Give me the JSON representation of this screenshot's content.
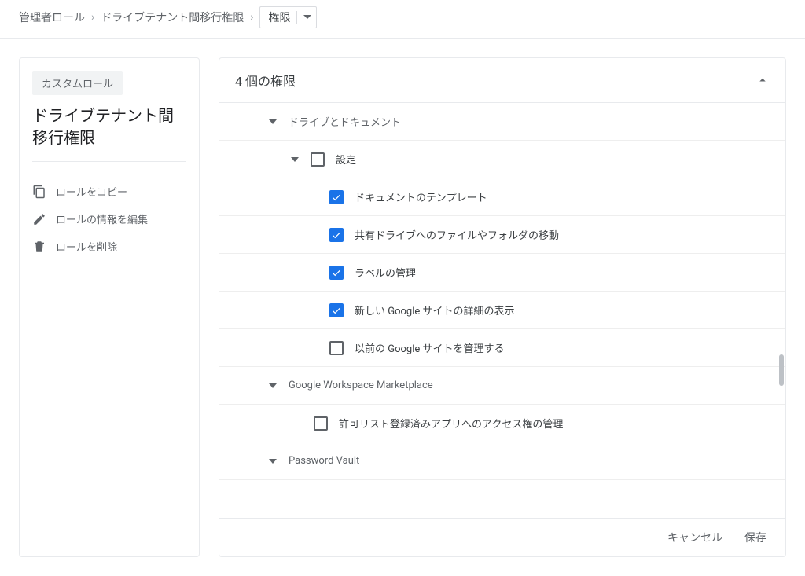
{
  "breadcrumb": {
    "level1": "管理者ロール",
    "level2": "ドライブテナント間移行権限",
    "dropdown_label": "権限"
  },
  "sidebar": {
    "badge": "カスタムロール",
    "title": "ドライブテナント間移行権限",
    "actions": {
      "copy": "ロールをコピー",
      "edit": "ロールの情報を編集",
      "delete": "ロールを削除"
    }
  },
  "panel": {
    "title": "4 個の権限"
  },
  "tree": {
    "group_drive_docs": "ドライブとドキュメント",
    "group_settings": "設定",
    "item_templates": "ドキュメントのテンプレート",
    "item_shared_drive_move": "共有ドライブへのファイルやフォルダの移動",
    "item_label_mgmt": "ラベルの管理",
    "item_new_sites_detail": "新しい Google サイトの詳細の表示",
    "item_old_sites_manage": "以前の Google サイトを管理する",
    "group_marketplace": "Google Workspace Marketplace",
    "item_allowlist_apps": "許可リスト登録済みアプリへのアクセス権の管理",
    "group_password_vault": "Password Vault"
  },
  "footer": {
    "cancel": "キャンセル",
    "save": "保存"
  }
}
